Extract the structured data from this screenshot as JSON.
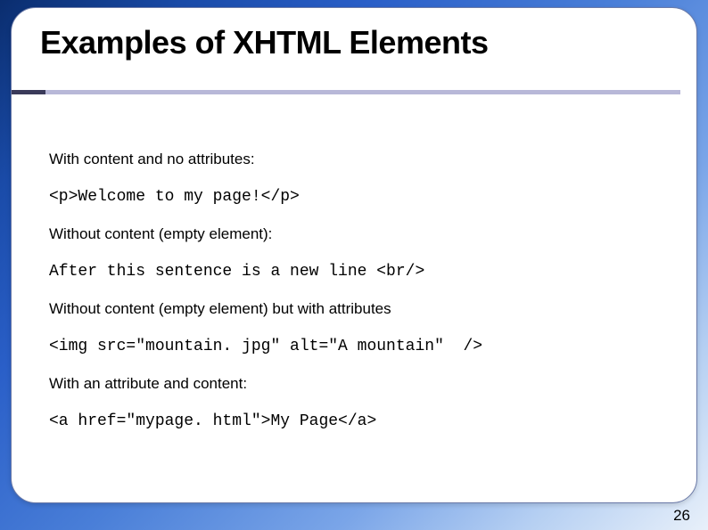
{
  "slide": {
    "title": "Examples of XHTML Elements",
    "sections": {
      "label1": "With content and no attributes:",
      "code1": "<p>Welcome to my page!</p>",
      "label2": "Without content (empty element):",
      "code2": "After this sentence is a new line <br/>",
      "label3": "Without content (empty element) but with attributes",
      "code3": "<img src=\"mountain. jpg\" alt=\"A mountain\"  />",
      "label4": "With an attribute and content:",
      "code4": "<a href=\"mypage. html\">My Page</a>"
    },
    "pageNumber": "26"
  }
}
